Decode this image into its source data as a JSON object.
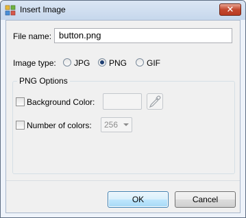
{
  "window": {
    "title": "Insert Image",
    "close_glyph": "✕"
  },
  "form": {
    "file_name_label": "File name:",
    "file_name_value": "button.png",
    "image_type_label": "Image type:",
    "image_types": [
      {
        "label": "JPG",
        "selected": false
      },
      {
        "label": "PNG",
        "selected": true
      },
      {
        "label": "GIF",
        "selected": false
      }
    ]
  },
  "png_options": {
    "title": "PNG Options",
    "background_color_label": "Background Color:",
    "background_color_checked": false,
    "number_of_colors_label": "Number of colors:",
    "number_of_colors_checked": false,
    "number_of_colors_value": "256"
  },
  "buttons": {
    "ok": "OK",
    "cancel": "Cancel"
  },
  "colors": {
    "accent": "#3c7fb1",
    "title_bar": "#c6d7ec",
    "close": "#c3482f"
  }
}
